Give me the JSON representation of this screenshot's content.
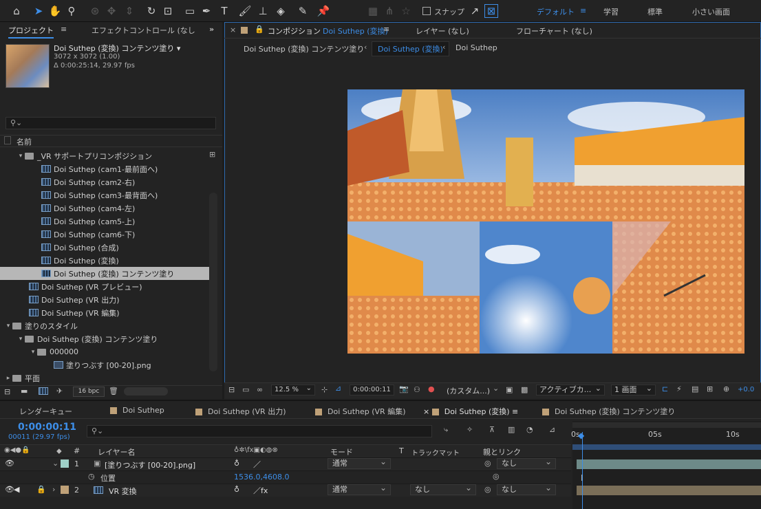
{
  "toolbar": {
    "snap_label": "スナップ",
    "workspaces": [
      "デフォルト",
      "学習",
      "標準",
      "小さい画面"
    ]
  },
  "project_panel": {
    "tab_project": "プロジェクト",
    "tab_effects": "エフェクトコントロール (なし",
    "selected_name": "Doi Suthep (変換) コンテンツ塗り ▾",
    "selected_dims": "3072 x 3072 (1.00)",
    "selected_duration": "Δ 0:00:25:14, 29.97 fps",
    "search_icon": "⚲⌄",
    "col_name": "名前",
    "items": [
      {
        "label": "_VR サポートプリコンポジション",
        "type": "folder",
        "indent": 1,
        "arrow": "▾"
      },
      {
        "label": "Doi Suthep (cam1-最前面へ)",
        "type": "comp",
        "indent": 3
      },
      {
        "label": "Doi Suthep (cam2-右)",
        "type": "comp",
        "indent": 3
      },
      {
        "label": "Doi Suthep (cam3-最背面へ)",
        "type": "comp",
        "indent": 3
      },
      {
        "label": "Doi Suthep (cam4-左)",
        "type": "comp",
        "indent": 3
      },
      {
        "label": "Doi Suthep (cam5-上)",
        "type": "comp",
        "indent": 3
      },
      {
        "label": "Doi Suthep (cam6-下)",
        "type": "comp",
        "indent": 3
      },
      {
        "label": "Doi Suthep (合成)",
        "type": "comp",
        "indent": 3
      },
      {
        "label": "Doi Suthep (変換)",
        "type": "comp",
        "indent": 3
      },
      {
        "label": "Doi Suthep (変換) コンテンツ塗り",
        "type": "comp",
        "indent": 3,
        "selected": true
      },
      {
        "label": "Doi Suthep (VR プレビュー)",
        "type": "comp",
        "indent": 2
      },
      {
        "label": "Doi Suthep (VR 出力)",
        "type": "comp",
        "indent": 2
      },
      {
        "label": "Doi Suthep (VR 編集)",
        "type": "comp",
        "indent": 2
      },
      {
        "label": "塗りのスタイル",
        "type": "folder",
        "indent": 0,
        "arrow": "▾"
      },
      {
        "label": "Doi Suthep (変換) コンテンツ塗り",
        "type": "folder",
        "indent": 1,
        "arrow": "▾"
      },
      {
        "label": "000000",
        "type": "folder",
        "indent": 2,
        "arrow": "▾"
      },
      {
        "label": "塗りつぶす [00-20].png",
        "type": "file",
        "indent": 4
      },
      {
        "label": "平面",
        "type": "folder",
        "indent": 0,
        "arrow": "▸"
      }
    ],
    "bpc": "16 bpc"
  },
  "viewer": {
    "tab_comp": "コンポジション",
    "tab_comp_name": "Doi Suthep (変換)",
    "tab_layer": "レイヤー (なし)",
    "tab_flow": "フローチャート (なし)",
    "crumbs": [
      "Doi Suthep (変換) コンテンツ塗り",
      "Doi Suthep (変換)",
      "Doi Suthep"
    ],
    "zoom": "12.5 %",
    "timecode": "0:00:00:11",
    "view_mode": "(カスタム...)",
    "camera": "アクティブカ...",
    "views": "1 画面",
    "exposure": "+0.0"
  },
  "timeline": {
    "tabs": [
      "レンダーキュー",
      "Doi Suthep",
      "Doi Suthep (VR 出力)",
      "Doi Suthep (VR 編集)",
      "Doi Suthep (変換)",
      "Doi Suthep (変換) コンテンツ塗り"
    ],
    "tab_colors": [
      "#bfa178",
      "#bfa178",
      "#bfa178",
      "#bfa178",
      "#bfa178"
    ],
    "current_time": "0:00:00:11",
    "frame_info": "00011 (29.97 fps)",
    "col_layer_name": "レイヤー名",
    "col_mode": "モード",
    "col_trkmat": "トラックマット",
    "col_parent": "親とリンク",
    "col_t": "T",
    "col_num": "#",
    "ruler": [
      "0s",
      "05s",
      "10s"
    ],
    "layers": [
      {
        "num": "1",
        "name": "[塗りつぶす [00-20].png]",
        "mode": "通常",
        "parent": "なし",
        "color": "#9fd0c8"
      },
      {
        "num": "2",
        "name": "VR 変換",
        "mode": "通常",
        "trkmat": "なし",
        "parent": "なし",
        "color": "#bfa178"
      }
    ],
    "position_label": "位置",
    "position_value": "1536.0,4608.0"
  }
}
